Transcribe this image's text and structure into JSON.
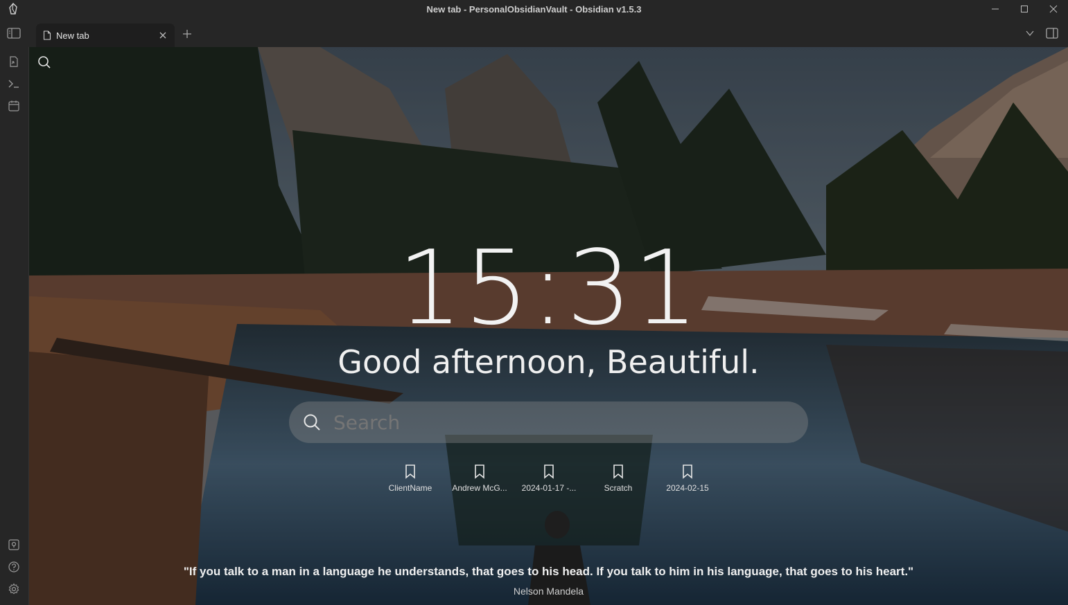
{
  "window": {
    "title": "New tab - PersonalObsidianVault - Obsidian v1.5.3",
    "controls": [
      "minimize-icon",
      "maximize-icon",
      "close-icon"
    ]
  },
  "tabs": [
    {
      "label": "New tab",
      "icon": "document-icon",
      "active": true
    }
  ],
  "ribbon": {
    "top": [
      "open-quick-switcher-icon",
      "terminal-icon",
      "calendar-icon"
    ],
    "bottom": [
      "vault-icon",
      "help-icon",
      "settings-icon"
    ]
  },
  "home": {
    "clock": "15:31",
    "greeting": "Good afternoon, Beautiful.",
    "search_placeholder": "Search",
    "bookmarks": [
      {
        "label": "ClientName",
        "icon": "bookmark-icon"
      },
      {
        "label": "Andrew McG...",
        "icon": "bookmark-icon"
      },
      {
        "label": "2024-01-17 -...",
        "icon": "bookmark-icon"
      },
      {
        "label": "Scratch",
        "icon": "bookmark-icon"
      },
      {
        "label": "2024-02-15",
        "icon": "bookmark-icon"
      }
    ],
    "quote": "\"If you talk to a man in a language he understands, that goes to his head. If you talk to him in his language, that goes to his heart.\"",
    "quote_author": "Nelson Mandela"
  },
  "colors": {
    "chrome": "#262626",
    "workspace": "#1e1e1e",
    "text": "#dcddde"
  }
}
